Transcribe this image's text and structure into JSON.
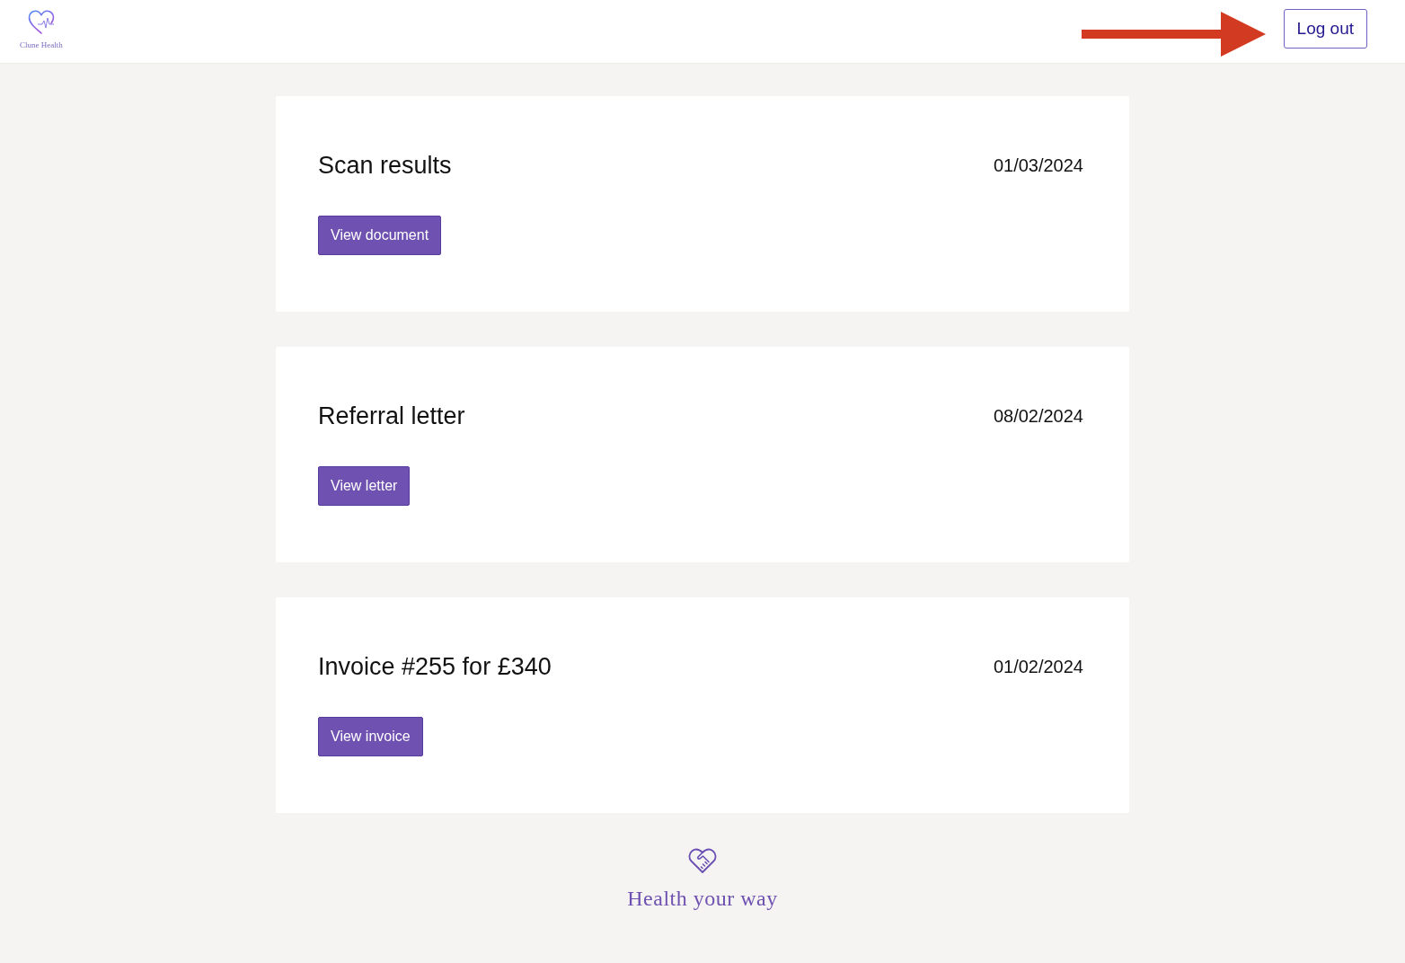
{
  "header": {
    "logo_text": "Clune Health",
    "logout_button": "Log out"
  },
  "documents": [
    {
      "title": "Scan results",
      "date": "01/03/2024",
      "button": "View document"
    },
    {
      "title": "Referral letter",
      "date": "08/02/2024",
      "button": "View letter"
    },
    {
      "title": "Invoice #255 for £340",
      "date": "01/02/2024",
      "button": "View invoice"
    }
  ],
  "footer": {
    "tagline": "Health your way"
  }
}
